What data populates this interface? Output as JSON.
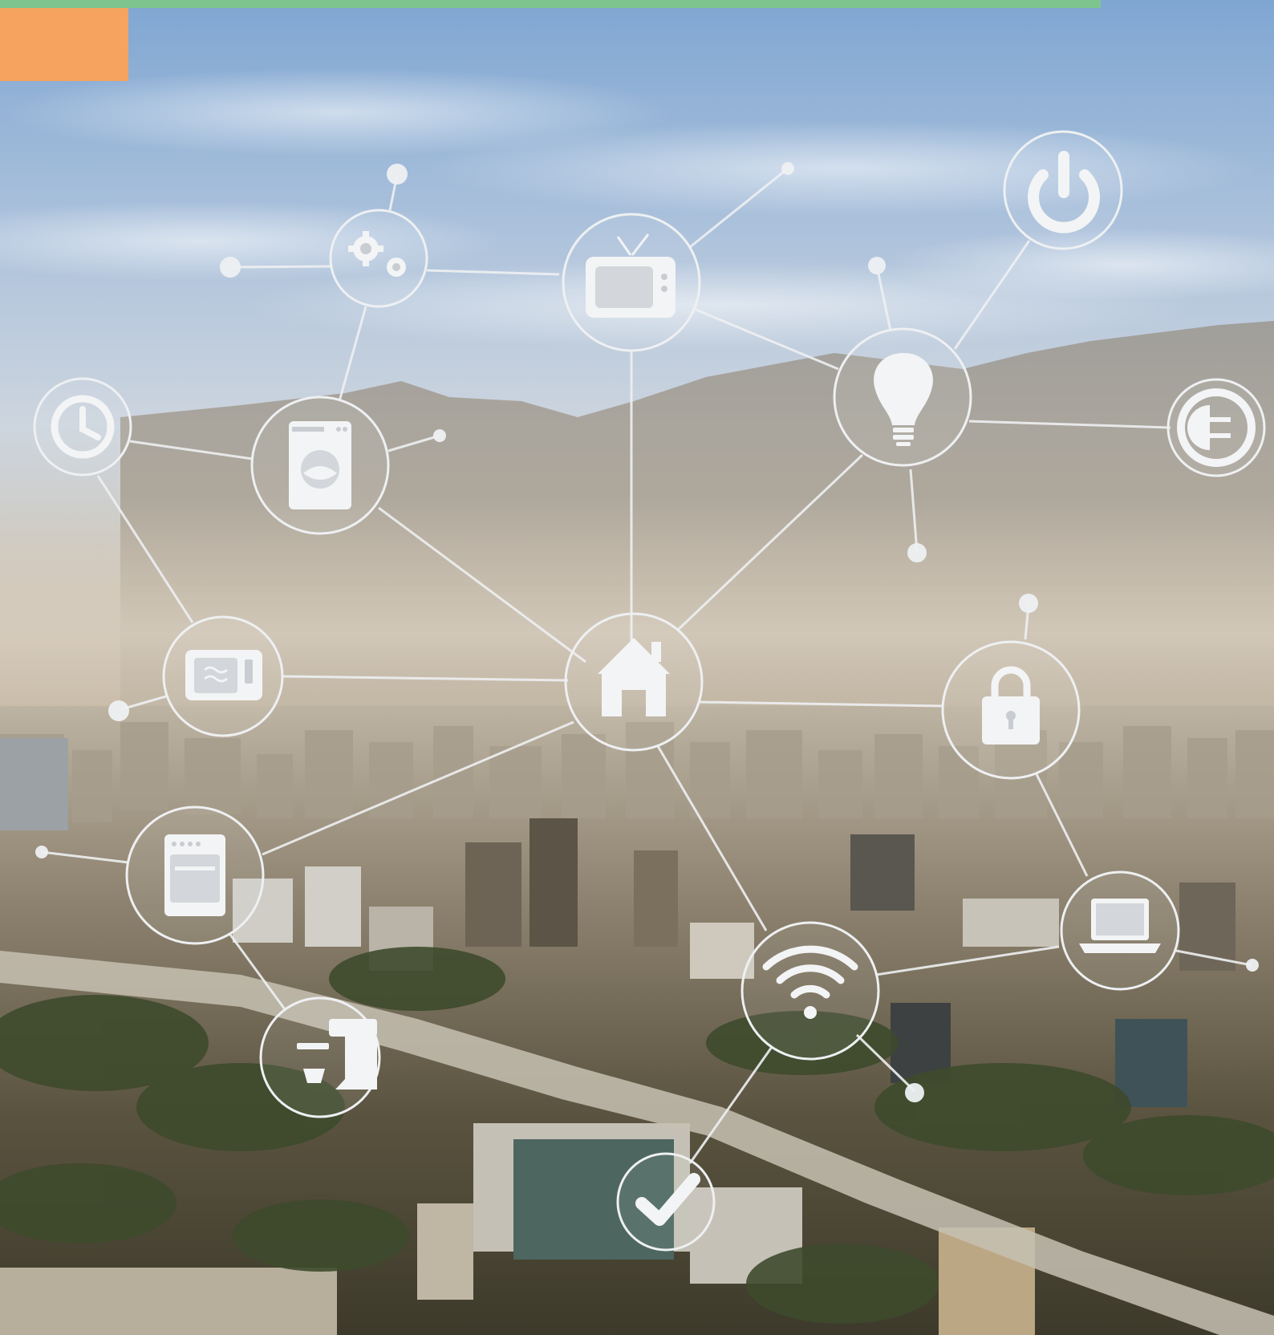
{
  "colors": {
    "top_bar": "#7dc58f",
    "corner_block": "#f5a35f",
    "sky_top": "#8fb3d9",
    "sky_mid": "#c9d3df",
    "haze": "#c8b8a2",
    "mountains": "#9a958c",
    "city_light": "#c7c0b4",
    "city_mid": "#8a8170",
    "city_dark": "#4a4436",
    "trees": "#3f4a2e",
    "network_line": "#e9ecef",
    "icon_fill": "#f3f4f5"
  },
  "network": {
    "hub_icon": "house-icon",
    "nodes": [
      "gears-icon",
      "tv-icon",
      "power-icon",
      "lightbulb-icon",
      "plug-icon",
      "clock-icon",
      "washing-machine-icon",
      "microwave-icon",
      "lock-icon",
      "oven-icon",
      "wifi-icon",
      "laptop-icon",
      "coffee-machine-icon",
      "checkmark-icon"
    ]
  }
}
